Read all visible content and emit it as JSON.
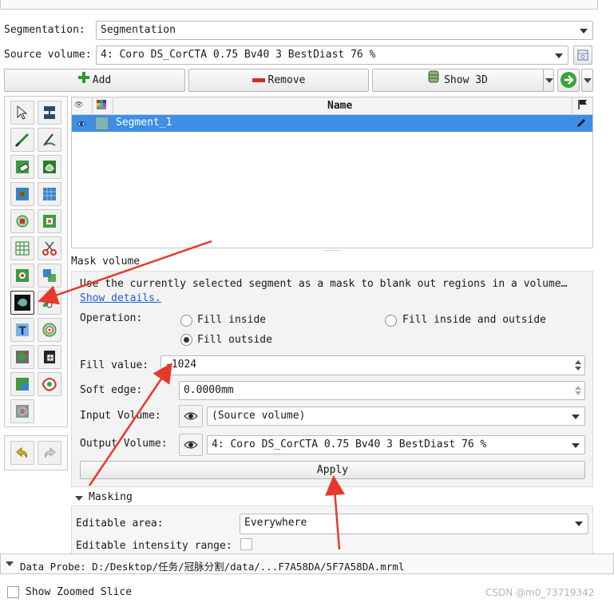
{
  "header": {
    "segmentation_label": "Segmentation:",
    "segmentation_value": "Segmentation",
    "source_label": "Source volume:",
    "source_value": "4: Coro  DS_CorCTA  0.75  Bv40  3  BestDiast 76 %"
  },
  "toolbar": {
    "add_label": "Add",
    "remove_label": "Remove",
    "show3d_label": "Show 3D"
  },
  "segments_table": {
    "column_name": "Name",
    "rows": [
      {
        "name": "Segment_1",
        "color": "#80b3b3"
      }
    ]
  },
  "colors": {
    "selection": "#3d8ee6",
    "segment": "#7fb2b2",
    "arrow": "#e8382c"
  },
  "mask_volume": {
    "title": "Mask volume",
    "description": "Use the currently selected segment as a mask to blank out regions in a volume…",
    "show_details": "Show details.",
    "operation_label": "Operation:",
    "options": [
      "Fill inside",
      "Fill outside",
      "Fill inside and outside"
    ],
    "selected_option": "Fill outside",
    "fill_value_label": "Fill value:",
    "fill_value": "-1024",
    "soft_edge_label": "Soft edge:",
    "soft_edge_value": "0.0000mm",
    "input_volume_label": "Input Volume:",
    "input_volume_value": "(Source volume)",
    "output_volume_label": "Output Volume:",
    "output_volume_value": "4: Coro  DS_CorCTA  0.75  Bv40  3  BestDiast 76 %",
    "apply_label": "Apply"
  },
  "masking": {
    "title": "Masking",
    "editable_area_label": "Editable area:",
    "editable_area_value": "Everywhere",
    "intensity_range_label": "Editable intensity range:"
  },
  "footer": {
    "data_probe": "Data Probe: D:/Desktop/任务/冠脉分割/data/...F7A58DA/5F7A58DA.mrml",
    "show_zoomed_slice": "Show Zoomed Slice",
    "watermark": "CSDN @m0_73719342"
  },
  "tools": [
    "pointer-icon",
    "threshold-icon",
    "paint-icon",
    "draw-icon",
    "erase-icon",
    "level-tracing-icon",
    "grow-from-seeds-icon",
    "fill-between-slices-icon",
    "margin-icon",
    "hollow-icon",
    "smoothing-icon",
    "scissors-icon",
    "islands-icon",
    "logical-operators-icon",
    "mask-volume-icon",
    "draw-tube-icon",
    "local-threshold-icon",
    "surface-cut-icon",
    "watershed-icon",
    "engrave-icon",
    "split-volume-icon",
    "wrap-solidify-icon",
    "brain-icon",
    "undo-icon",
    "redo-icon"
  ]
}
